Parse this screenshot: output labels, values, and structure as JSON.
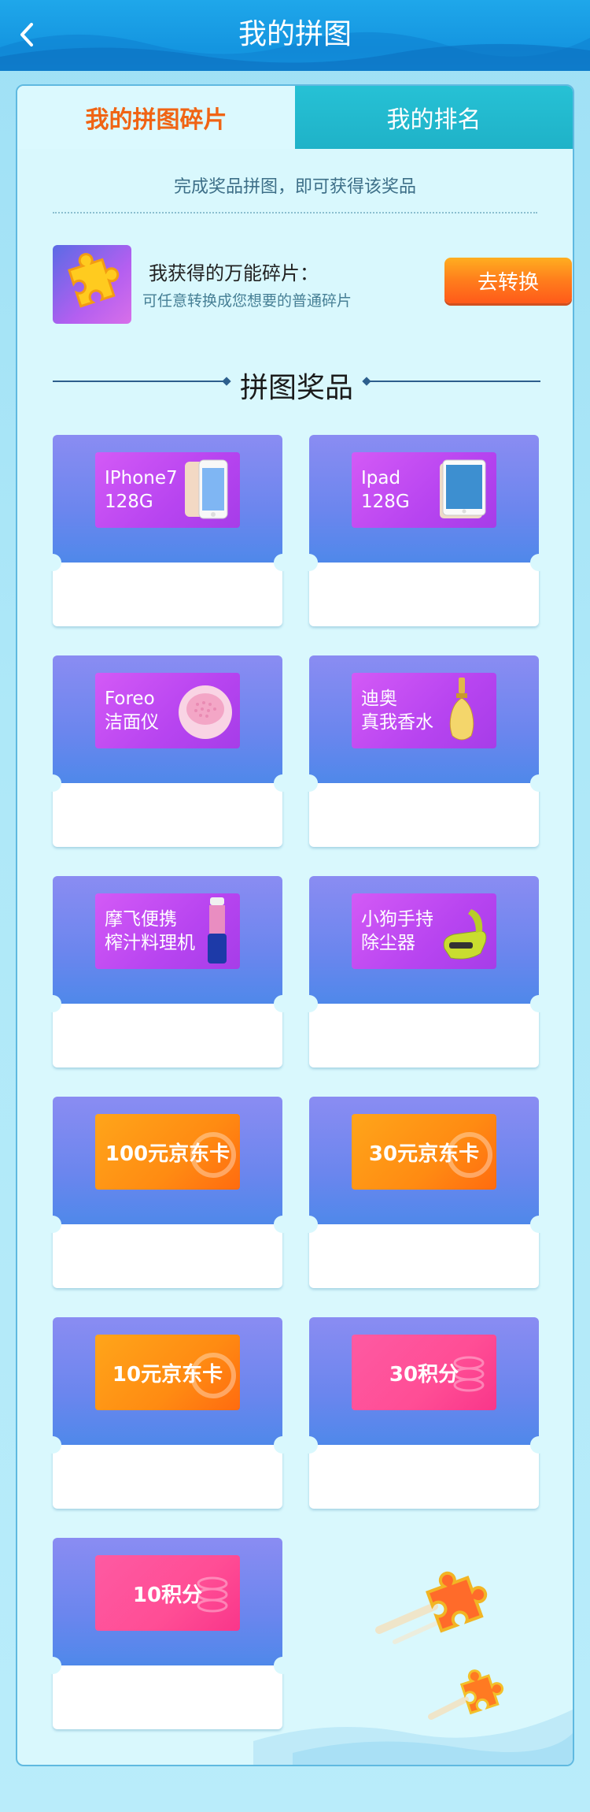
{
  "header": {
    "title": "我的拼图"
  },
  "tabs": [
    {
      "label": "我的拼图碎片",
      "active": true
    },
    {
      "label": "我的排名",
      "active": false
    }
  ],
  "intro": "完成奖品拼图，即可获得该奖品",
  "universal": {
    "title": "我获得的万能碎片：",
    "desc": "可任意转换成您想要的普通碎片",
    "button": "去转换"
  },
  "section_title": "拼图奖品",
  "prizes": [
    {
      "name": "IPhone7\n128G",
      "style": "purple",
      "icon": "iphone-icon"
    },
    {
      "name": "Ipad\n128G",
      "style": "purple",
      "icon": "ipad-icon"
    },
    {
      "name": "Foreo\n洁面仪",
      "style": "purple",
      "icon": "foreo-cleanser-icon"
    },
    {
      "name": "迪奥\n真我香水",
      "style": "purple",
      "icon": "perfume-bottle-icon"
    },
    {
      "name": "摩飞便携\n榨汁料理机",
      "style": "purple",
      "icon": "blender-icon"
    },
    {
      "name": "小狗手持\n除尘器",
      "style": "purple",
      "icon": "handheld-vacuum-icon"
    },
    {
      "name": "100元京东卡",
      "style": "orange",
      "icon": "jd-watermark-icon"
    },
    {
      "name": "30元京东卡",
      "style": "orange",
      "icon": "jd-watermark-icon"
    },
    {
      "name": "10元京东卡",
      "style": "orange",
      "icon": "jd-watermark-icon"
    },
    {
      "name": "30积分",
      "style": "pink",
      "icon": "coins-icon"
    },
    {
      "name": "10积分",
      "style": "pink",
      "icon": "coins-icon"
    }
  ],
  "colors": {
    "header": "#1495e0",
    "active_tab_text": "#f06414",
    "inactive_tab_bg": "#1fb2c8",
    "button": "#ff7d1c"
  }
}
